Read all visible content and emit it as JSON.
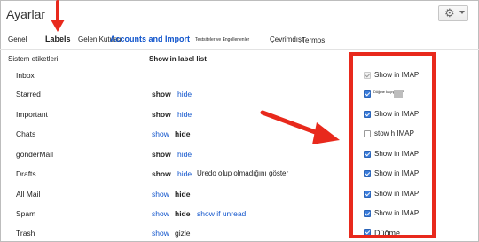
{
  "header": {
    "title": "Ayarlar",
    "gear_icon": "gear-icon"
  },
  "tabs": [
    {
      "label": "Genel"
    },
    {
      "label": "Labels"
    },
    {
      "label": "Gelen Kutusu"
    },
    {
      "label": "Accounts and Import"
    },
    {
      "label": "Testsiteler ve Engellenenler"
    },
    {
      "label": "Çevrimdışı"
    },
    {
      "label": "Termos"
    }
  ],
  "section": {
    "heading": "Sistem etiketleri",
    "column_header": "Show in label list"
  },
  "rows": [
    {
      "label": "Inbox",
      "show": "",
      "hide": "",
      "extra": "",
      "imap": "Show in IMAP"
    },
    {
      "label": "Starred",
      "show": "show",
      "hide": "hide",
      "extra": "",
      "imap": "Düğme kaçış IMAP"
    },
    {
      "label": "Important",
      "show": "show",
      "hide": "hide",
      "extra": "",
      "imap": "Show in IMAP"
    },
    {
      "label": "Chats",
      "show": "show",
      "hide": "hide",
      "extra": "",
      "imap": "stow h IMAP"
    },
    {
      "label": "gönderMail",
      "show": "show",
      "hide": "hide",
      "extra": "",
      "imap": "Show in IMAP"
    },
    {
      "label": "Drafts",
      "show": "show",
      "hide": "hide",
      "extra": "Uredo olup olmadığını göster",
      "imap": "Show in IMAP"
    },
    {
      "label": "All Mail",
      "show": "show",
      "hide": "hide",
      "extra": "",
      "imap": "Show in IMAP"
    },
    {
      "label": "Spam",
      "show": "show",
      "hide": "hide",
      "extra": "show if unread",
      "imap": "Show in IMAP"
    },
    {
      "label": "Trash",
      "show": "show",
      "hide": "gizle",
      "extra": "",
      "imap": "Düğme"
    }
  ],
  "colors": {
    "link": "#1155cc",
    "annotation_red": "#e8291c",
    "checkbox_blue": "#3b7ddd"
  }
}
